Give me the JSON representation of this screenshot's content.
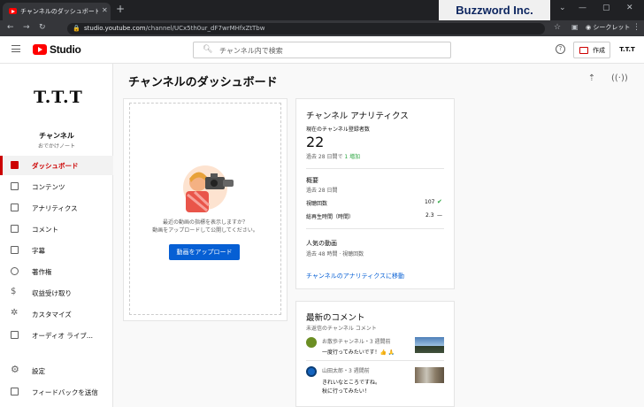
{
  "browser": {
    "tab_title": "チャンネルのダッシュボード - YouTube Studio",
    "tab_close": "✕",
    "new_tab": "+",
    "brand": "Buzzword Inc.",
    "url_host": "studio.youtube.com",
    "url_path": "/channel/UCx5th0ur_dF7wrMHfxZtTbw",
    "incognito_label": "シークレット"
  },
  "header": {
    "logo_text": "Studio",
    "search_placeholder": "チャンネル内で検索",
    "help": "?",
    "create_label": "作成",
    "account_initials": "T.T.T"
  },
  "sidebar": {
    "avatar_text": "T.T.T",
    "channel_label": "チャンネル",
    "channel_name": "おでかけノート",
    "items": [
      {
        "label": "ダッシュボード",
        "active": true
      },
      {
        "label": "コンテンツ"
      },
      {
        "label": "アナリティクス"
      },
      {
        "label": "コメント"
      },
      {
        "label": "字幕"
      },
      {
        "label": "著作権"
      },
      {
        "label": "収益受け取り"
      },
      {
        "label": "カスタマイズ"
      },
      {
        "label": "オーディオ ライブ..."
      }
    ],
    "bottom": [
      {
        "label": "設定"
      },
      {
        "label": "フィードバックを送信"
      }
    ]
  },
  "main": {
    "page_title": "チャンネルのダッシュボード",
    "upload_card": {
      "line1": "最近の動画の指標を表示しますか？",
      "line2": "動画をアップロードして公開してください。",
      "button": "動画をアップロード"
    },
    "analytics": {
      "title": "チャンネル アナリティクス",
      "subs_label": "現在のチャンネル登録者数",
      "subs_value": "22",
      "subs_change_prefix": "過去 28 日間で",
      "subs_change": "1 増加",
      "summary_title": "概要",
      "summary_period": "過去 28 日間",
      "views_label": "視聴回数",
      "views_value": "107",
      "watch_label": "総再生時間（時間）",
      "watch_value": "2.3",
      "watch_trend": "—",
      "top_title": "人気の動画",
      "top_period": "過去 48 時間 · 視聴回数",
      "link": "チャンネルのアナリティクスに移動"
    },
    "comments": {
      "title": "最新のコメント",
      "subtitle": "未返信のチャンネル コメント",
      "items": [
        {
          "author_time": "お散歩チャンネル・3 週間前",
          "text": "一度行ってみたいです！👍 🙏",
          "avatar_color": "#6b8e23"
        },
        {
          "author_time": "山田太郎・3 週間前",
          "text": "きれいなところですね。",
          "text2": "秋に行ってみたい！",
          "avatar_color": "#1565c0"
        }
      ]
    }
  },
  "colors": {
    "accent": "#cc0000",
    "link": "#065fd4",
    "positive": "#2ba640"
  }
}
